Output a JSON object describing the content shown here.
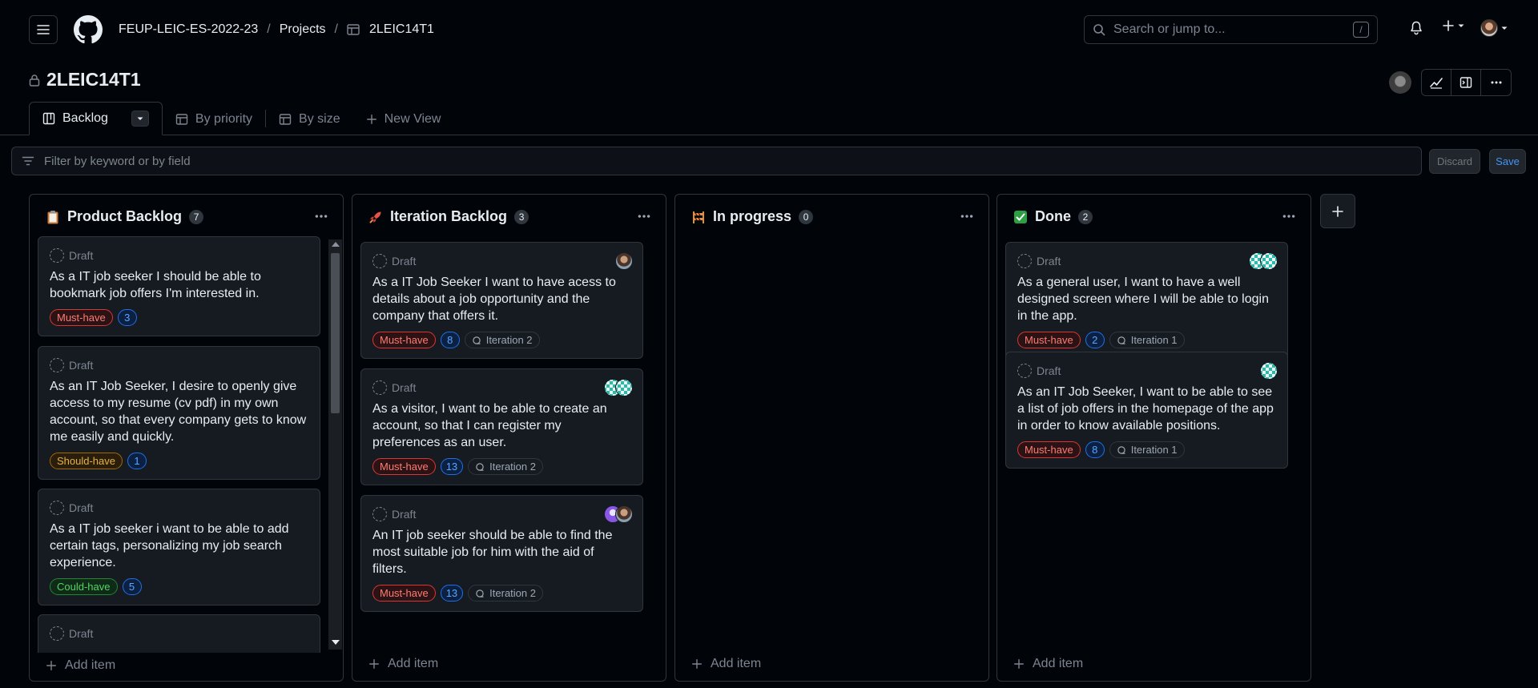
{
  "header": {
    "org": "FEUP-LEIC-ES-2022-23",
    "projects": "Projects",
    "project": "2LEIC14T1",
    "search_placeholder": "Search or jump to...",
    "search_shortcut": "/",
    "plus": "+"
  },
  "project": {
    "title": "2LEIC14T1"
  },
  "tabs": [
    {
      "label": "Backlog"
    },
    {
      "label": "By priority"
    },
    {
      "label": "By size"
    },
    {
      "label": "New View"
    }
  ],
  "filter": {
    "placeholder": "Filter by keyword or by field",
    "discard": "Discard",
    "save": "Save"
  },
  "columns": [
    {
      "title": "Product Backlog",
      "count": "7",
      "cards": [
        {
          "status": "Draft",
          "text": "As a IT job seeker I should be able to bookmark job offers I'm interested in.",
          "priority": "Must-have",
          "size": "3"
        },
        {
          "status": "Draft",
          "text": "As an IT Job Seeker, I desire to openly give access to my resume (cv pdf) in my own account, so that every company gets to know me easily and quickly.",
          "priority": "Should-have",
          "size": "1"
        },
        {
          "status": "Draft",
          "text": "As a IT job seeker i want to be able to add certain tags, personalizing my job search experience.",
          "priority": "Could-have",
          "size": "5"
        },
        {
          "status": "Draft"
        }
      ]
    },
    {
      "title": "Iteration Backlog",
      "count": "3",
      "cards": [
        {
          "status": "Draft",
          "text": "As a IT Job Seeker I want to have acess to details about a job opportunity and the company that offers it.",
          "priority": "Must-have",
          "size": "8",
          "iteration": "Iteration 2"
        },
        {
          "status": "Draft",
          "text": "As a visitor, I want to be able to create an account, so that I can register my preferences as an user.",
          "priority": "Must-have",
          "size": "13",
          "iteration": "Iteration 2"
        },
        {
          "status": "Draft",
          "text": "An IT job seeker should be able to find the most suitable job for him with the aid of filters.",
          "priority": "Must-have",
          "size": "13",
          "iteration": "Iteration 2"
        }
      ]
    },
    {
      "title": "In progress",
      "count": "0",
      "cards": []
    },
    {
      "title": "Done",
      "count": "2",
      "cards": [
        {
          "status": "Draft",
          "text": "As a general user, I want to have a well designed screen where I will be able to login in the app.",
          "priority": "Must-have",
          "size": "2",
          "iteration": "Iteration 1"
        },
        {
          "status": "Draft",
          "text": "As an IT Job Seeker, I want to be able to see a list of job offers in the homepage of the app in order to know available positions.",
          "priority": "Must-have",
          "size": "8",
          "iteration": "Iteration 1"
        }
      ]
    }
  ],
  "add_item": "Add item",
  "colors": {
    "bg": "#010409",
    "card": "#161b22",
    "border": "#30363d",
    "accent": "#4493f8",
    "must": "#ff7b72",
    "should": "#e3b341",
    "could": "#56d364"
  }
}
